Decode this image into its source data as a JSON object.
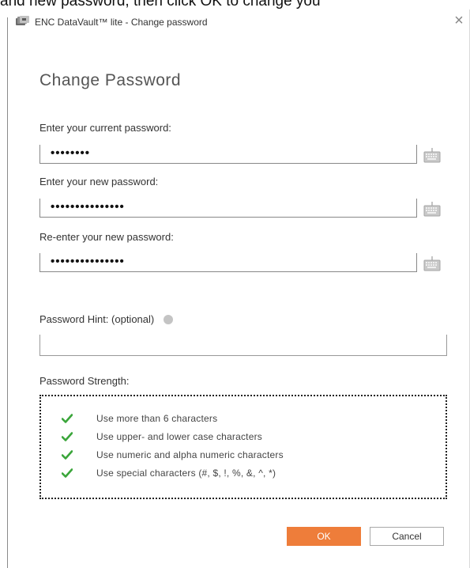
{
  "background_caption": "and new password, then click OK to change you",
  "window": {
    "title": "ENC DataVault™ lite - Change password",
    "close_symbol": "×",
    "app_icon": "enc-datavault-app-icon"
  },
  "dialog": {
    "heading": "Change Password",
    "fields": [
      {
        "label": "Enter your current password:",
        "value": "••••••••",
        "keyboard_icon": "keyboard-icon"
      },
      {
        "label": "Enter your new password:",
        "value": "•••••••••••••••",
        "keyboard_icon": "keyboard-icon"
      },
      {
        "label": "Re-enter your new password:",
        "value": "•••••••••••••••",
        "keyboard_icon": "keyboard-icon"
      }
    ],
    "hint": {
      "label": "Password Hint: (optional)",
      "value": "",
      "info_icon": "info-icon"
    },
    "strength": {
      "label": "Password Strength:",
      "requirements": [
        {
          "text": "Use more than 6 characters",
          "met": true
        },
        {
          "text": "Use upper- and lower case characters",
          "met": true
        },
        {
          "text": "Use numeric and alpha numeric characters",
          "met": true
        },
        {
          "text": "Use special characters (#, $, !, %, &, ^, *)",
          "met": true
        }
      ]
    },
    "buttons": {
      "ok": "OK",
      "cancel": "Cancel"
    }
  },
  "colors": {
    "accent": "#ee7d3a",
    "check": "#3aa53a",
    "heading": "#555555"
  }
}
